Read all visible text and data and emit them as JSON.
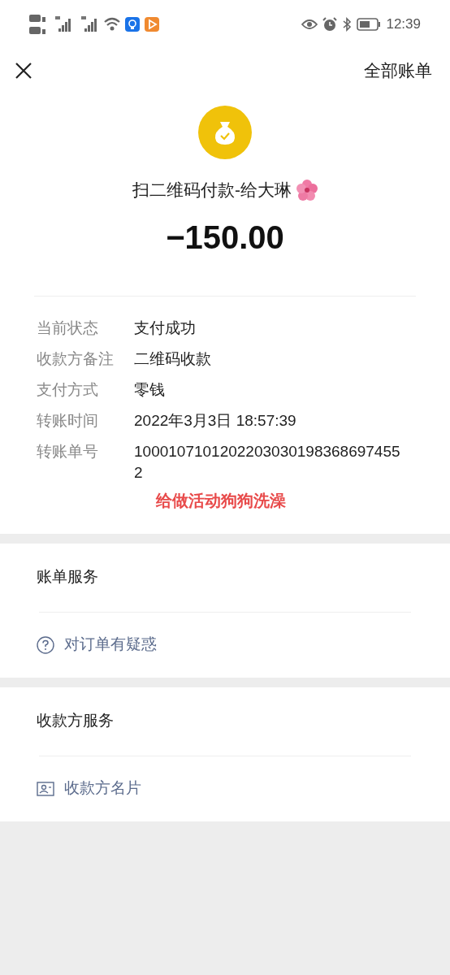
{
  "status_bar": {
    "time": "12:39"
  },
  "nav": {
    "right_link": "全部账单"
  },
  "header": {
    "title": "扫二维码付款-给大琳",
    "amount": "−150.00"
  },
  "details": [
    {
      "label": "当前状态",
      "value": "支付成功"
    },
    {
      "label": "收款方备注",
      "value": "二维码收款"
    },
    {
      "label": "支付方式",
      "value": "零钱"
    },
    {
      "label": "转账时间",
      "value": "2022年3月3日 18:57:39"
    },
    {
      "label": "转账单号",
      "value": "10001071012022030301983686974552"
    }
  ],
  "annotation": "给做活动狗狗洗澡",
  "sections": [
    {
      "title": "账单服务",
      "item": {
        "kind": "question",
        "label": "对订单有疑惑"
      }
    },
    {
      "title": "收款方服务",
      "item": {
        "kind": "card",
        "label": "收款方名片"
      }
    }
  ]
}
